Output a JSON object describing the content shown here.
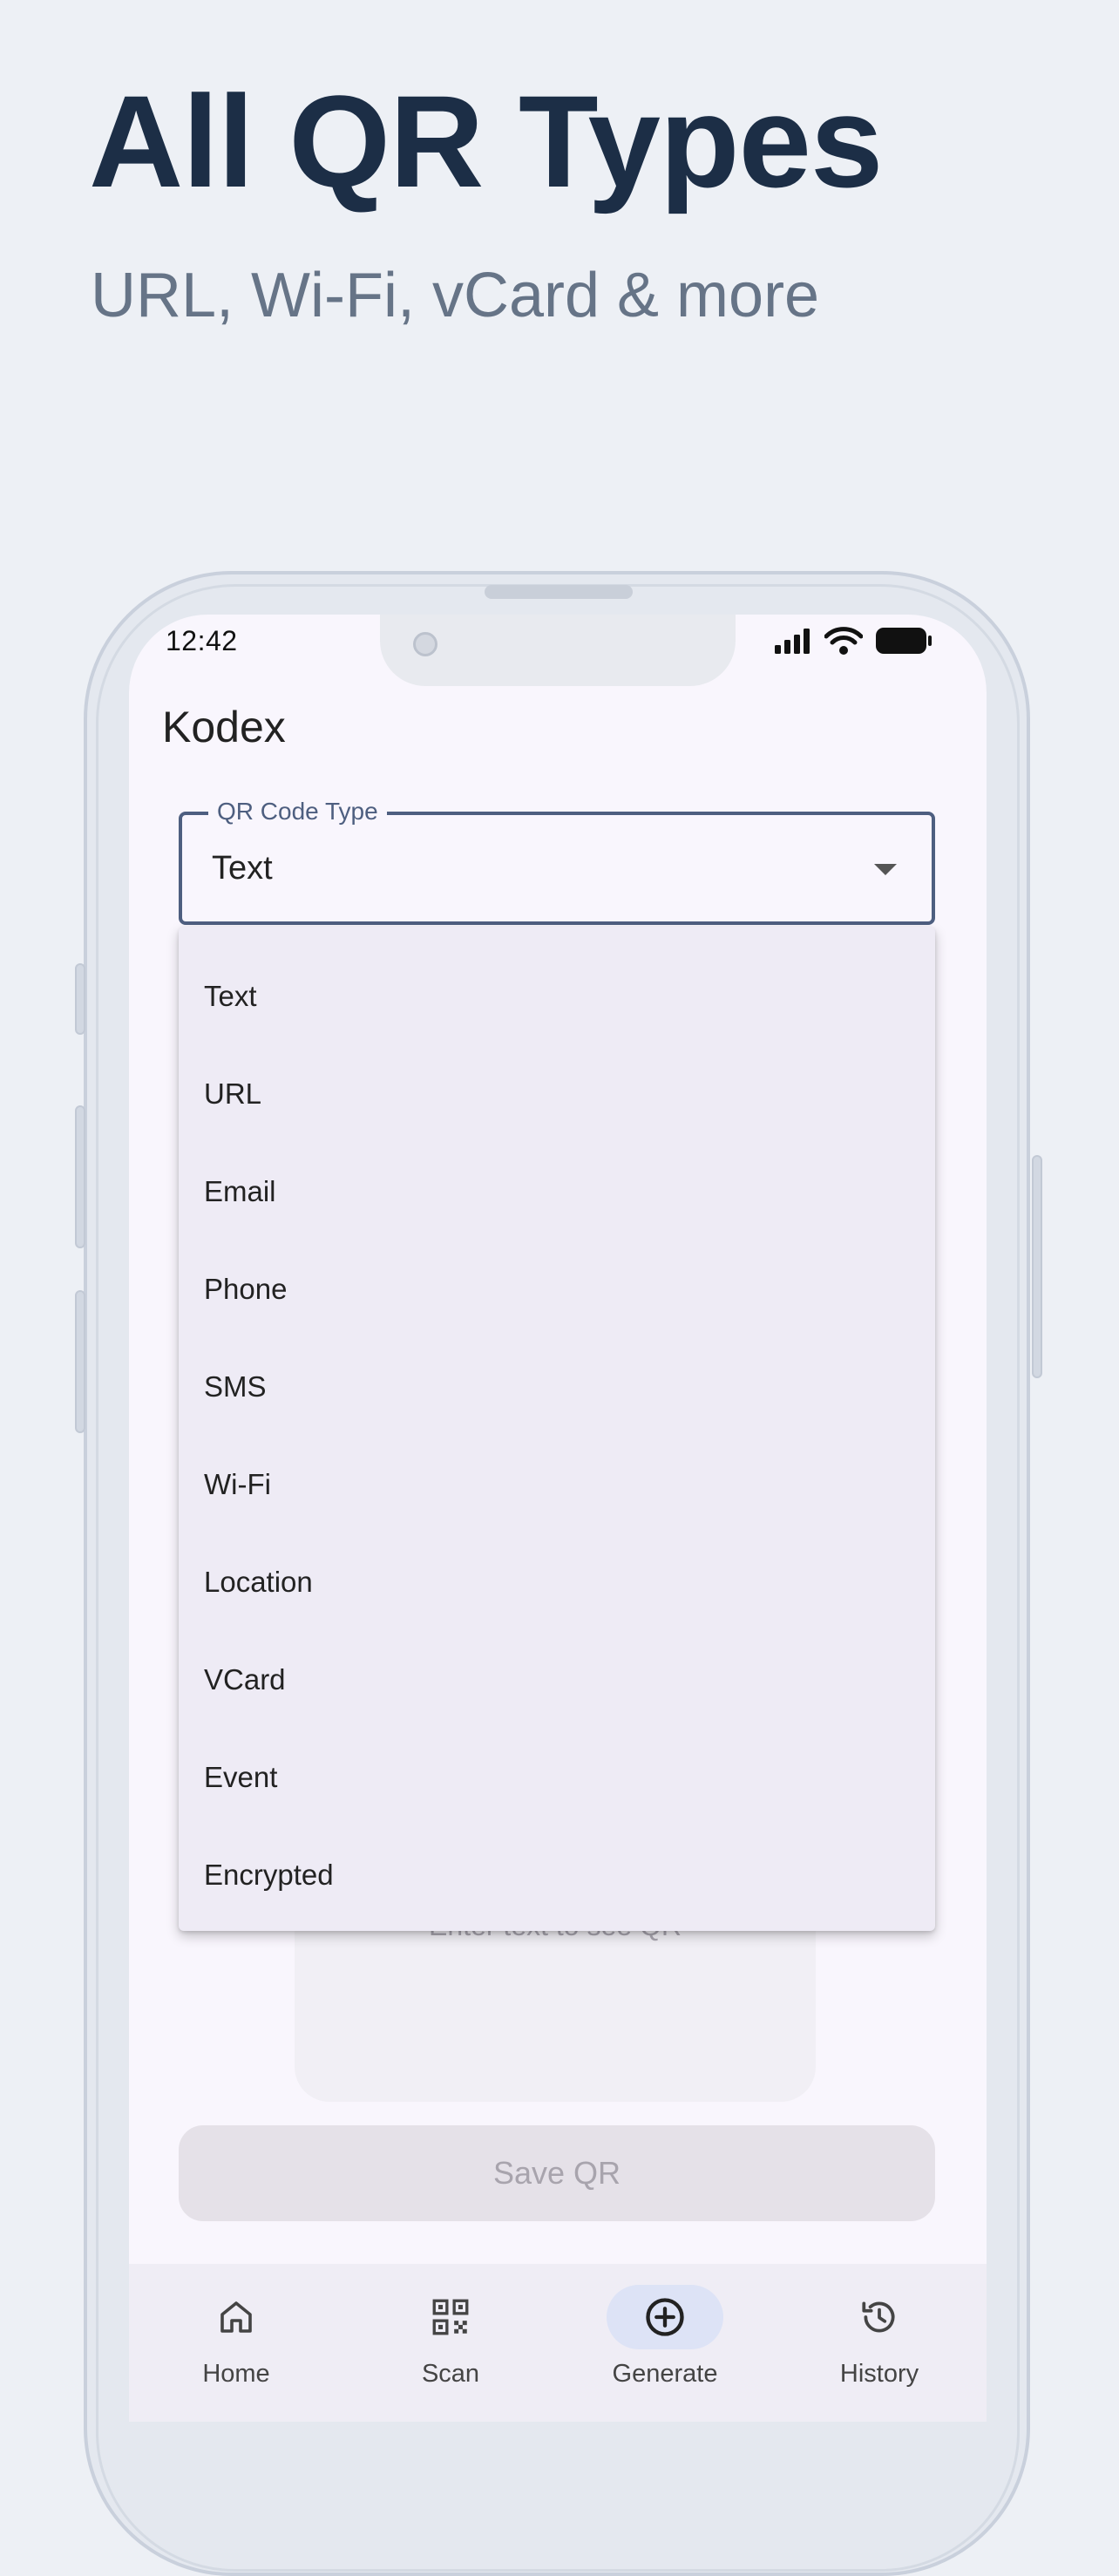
{
  "promo": {
    "headline": "All QR Types",
    "subheadline": "URL, Wi-Fi, vCard & more"
  },
  "status_bar": {
    "time": "12:42",
    "icons": [
      "signal-icon",
      "wifi-icon",
      "battery-icon"
    ]
  },
  "app": {
    "title": "Kodex"
  },
  "qr_type_field": {
    "label": "QR Code Type",
    "value": "Text"
  },
  "dropdown": {
    "options": [
      "Text",
      "URL",
      "Email",
      "Phone",
      "SMS",
      "Wi-Fi",
      "Location",
      "VCard",
      "Event",
      "Encrypted"
    ]
  },
  "preview": {
    "hint": "Enter text to see QR"
  },
  "save_button": {
    "label": "Save QR"
  },
  "bottom_nav": {
    "items": [
      {
        "label": "Home",
        "icon": "home-icon"
      },
      {
        "label": "Scan",
        "icon": "qr-scan-icon"
      },
      {
        "label": "Generate",
        "icon": "plus-circle-icon",
        "active": true
      },
      {
        "label": "History",
        "icon": "history-icon"
      }
    ]
  },
  "colors": {
    "background": "#edf0f5",
    "headline": "#1c2e46",
    "field_border": "#4e5f80",
    "active_nav_pill": "#dde3f6"
  }
}
